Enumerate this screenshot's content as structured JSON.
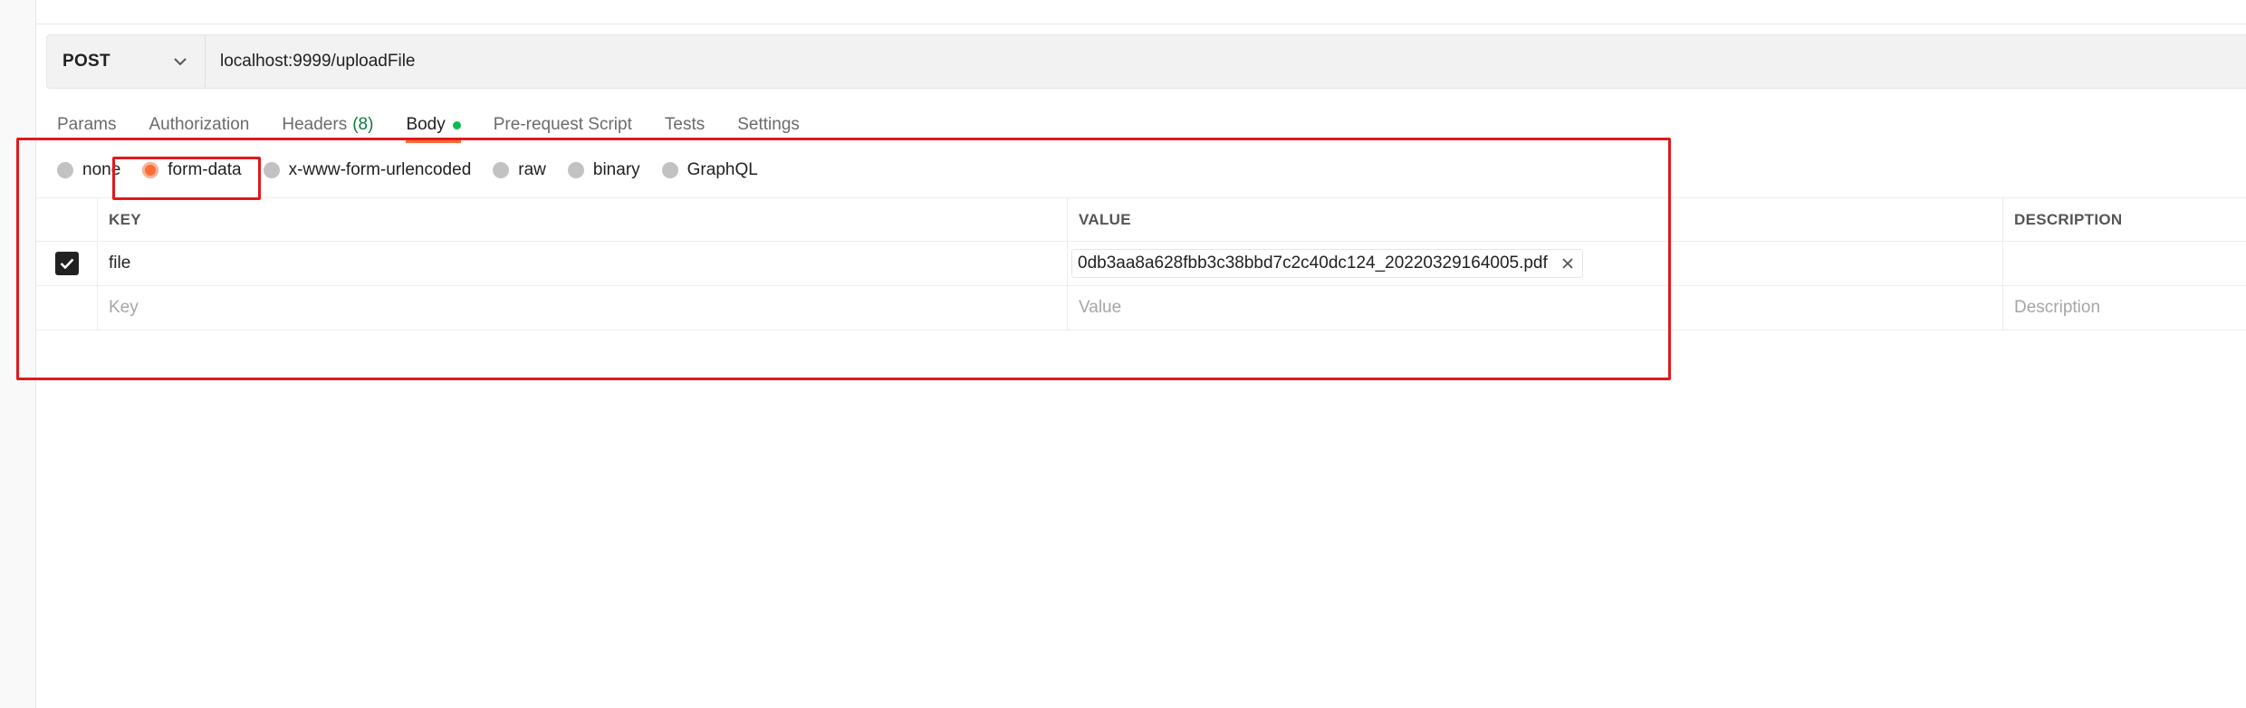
{
  "request": {
    "method": "POST",
    "url": "localhost:9999/uploadFile"
  },
  "tabs": [
    {
      "label": "Params"
    },
    {
      "label": "Authorization"
    },
    {
      "label": "Headers",
      "count": "(8)"
    },
    {
      "label": "Body",
      "active": true
    },
    {
      "label": "Pre-request Script"
    },
    {
      "label": "Tests"
    },
    {
      "label": "Settings"
    }
  ],
  "body_types": [
    {
      "label": "none"
    },
    {
      "label": "form-data",
      "selected": true
    },
    {
      "label": "x-www-form-urlencoded"
    },
    {
      "label": "raw"
    },
    {
      "label": "binary"
    },
    {
      "label": "GraphQL"
    }
  ],
  "table": {
    "headers": {
      "key": "KEY",
      "value": "VALUE",
      "description": "DESCRIPTION"
    },
    "rows": [
      {
        "checked": true,
        "key": "file",
        "value": "0db3aa8a628fbb3c38bbd7c2c40dc124_20220329164005.pdf",
        "description": ""
      }
    ],
    "placeholders": {
      "key": "Key",
      "value": "Value",
      "description": "Description"
    }
  },
  "colors": {
    "accent": "#ff6c37",
    "annotation": "#e0191e",
    "body_dot": "#0cbb52",
    "headers_count": "#0c7b3d"
  }
}
